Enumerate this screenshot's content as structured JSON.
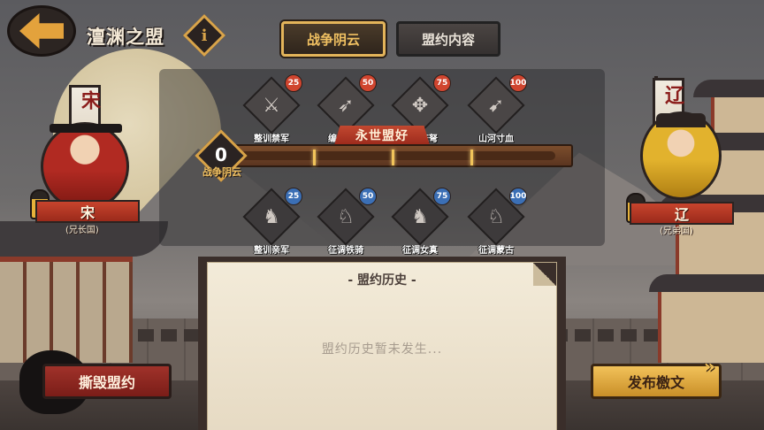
{
  "header": {
    "title": "澶渊之盟",
    "info_glyph": "i",
    "tabs": [
      {
        "label": "战争阴云",
        "active": true
      },
      {
        "label": "盟约内容",
        "active": false
      }
    ]
  },
  "nations": {
    "left": {
      "banner": "宋",
      "name": "宋",
      "sub": "(兄长国)"
    },
    "right": {
      "banner": "辽",
      "name": "辽",
      "sub": "(兄弟国)"
    }
  },
  "rewards_top": [
    {
      "label": "整训禁军",
      "badge": "25",
      "icon": "soldier-icon"
    },
    {
      "label": "编练厢军",
      "badge": "50",
      "icon": "spear-icon"
    },
    {
      "label": "三弓床弩",
      "badge": "75",
      "icon": "crossbow-icon"
    },
    {
      "label": "山河寸血",
      "badge": "100",
      "icon": "archer-icon"
    }
  ],
  "rewards_bottom": [
    {
      "label": "整训亲军",
      "badge": "25",
      "icon": "cavalry-icon"
    },
    {
      "label": "征调铁骑",
      "badge": "50",
      "icon": "knight-icon"
    },
    {
      "label": "征调女真",
      "badge": "75",
      "icon": "horseman-icon"
    },
    {
      "label": "征调蒙古",
      "badge": "100",
      "icon": "horse-archer-icon"
    }
  ],
  "progress": {
    "banner": "永世盟好",
    "level": "0",
    "level_label": "战争阴云",
    "fill_fraction": 0.0
  },
  "history": {
    "title": "- 盟约历史 -",
    "empty": "盟约历史暂未发生..."
  },
  "buttons": {
    "break": "撕毁盟约",
    "publish": "发布檄文"
  },
  "colors": {
    "accent_gold": "#f1c162",
    "accent_red": "#c24830",
    "badge_red": "#d0452f",
    "badge_blue": "#3b6fb5"
  }
}
